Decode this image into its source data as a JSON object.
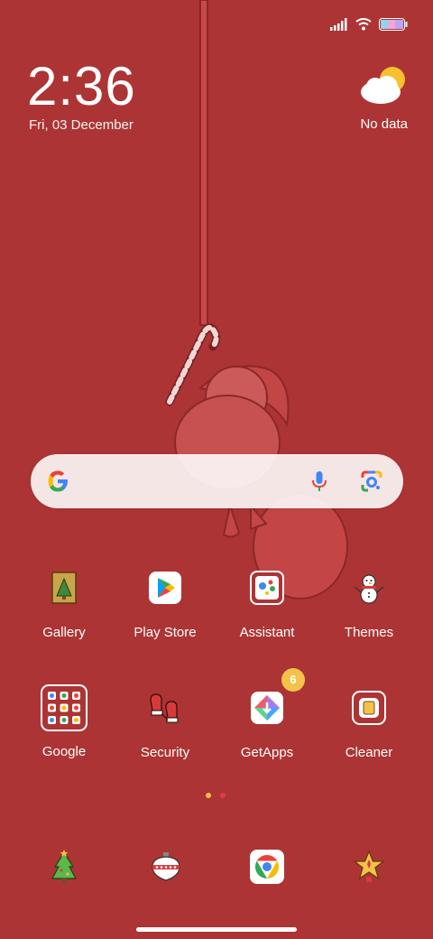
{
  "status_bar": {
    "icons": [
      "signal-icon",
      "wifi-icon",
      "battery-icon"
    ]
  },
  "clock": {
    "time": "2:36",
    "date": "Fri, 03 December"
  },
  "weather": {
    "icon": "partly-cloudy-icon",
    "text": "No data"
  },
  "search_bar": {
    "icons": [
      "google-g-icon",
      "microphone-icon",
      "lens-camera-icon"
    ]
  },
  "apps": [
    {
      "label": "Gallery",
      "icon": "gallery-card-icon"
    },
    {
      "label": "Play Store",
      "icon": "play-store-icon"
    },
    {
      "label": "Assistant",
      "icon": "assistant-icon"
    },
    {
      "label": "Themes",
      "icon": "snowman-icon"
    },
    {
      "label": "Google",
      "icon": "google-folder-icon"
    },
    {
      "label": "Security",
      "icon": "mittens-icon"
    },
    {
      "label": "GetApps",
      "icon": "getapps-icon",
      "badge": "6"
    },
    {
      "label": "Cleaner",
      "icon": "cleaner-icon"
    }
  ],
  "page_indicator": {
    "pages": 2,
    "current": 1,
    "colors": {
      "active": "#f3c24a",
      "inactive": "#d9403f"
    }
  },
  "dock": [
    {
      "icon": "christmas-tree-icon"
    },
    {
      "icon": "ornament-icon"
    },
    {
      "icon": "chrome-icon"
    },
    {
      "icon": "star-icon"
    }
  ],
  "colors": {
    "background": "#ad3434",
    "search_background": "#f4ecec",
    "badge": "#f3c24a"
  }
}
